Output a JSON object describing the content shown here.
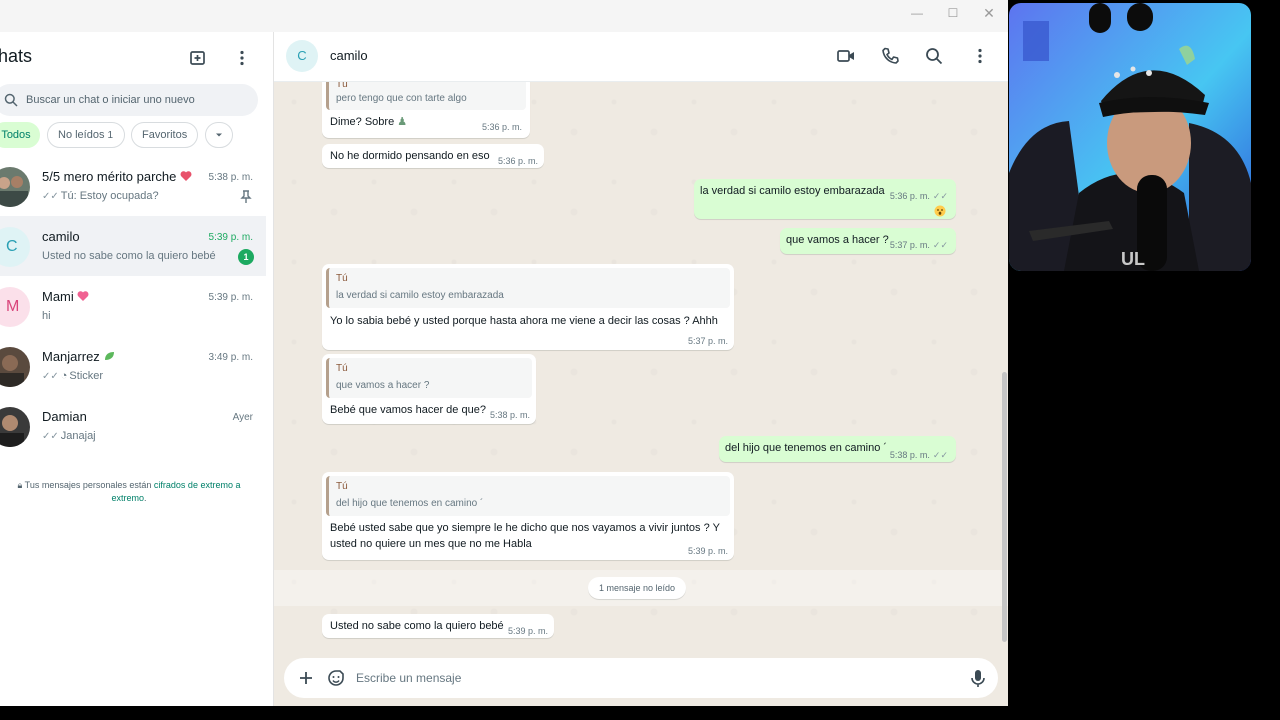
{
  "sidebar": {
    "title": "hats",
    "search_placeholder": "Buscar un chat o iniciar uno nuevo",
    "filters": [
      {
        "label": "Todos",
        "active": true
      },
      {
        "label": "No leídos",
        "count": "1",
        "active": false
      },
      {
        "label": "Favoritos",
        "active": false
      }
    ],
    "chats": [
      {
        "name": "5/5 mero mérito parche",
        "time": "5:38 p. m.",
        "preview": "Tú: Estoy ocupada?",
        "pinned": true
      },
      {
        "name": "camilo",
        "time": "5:39 p. m.",
        "preview": "Usted no sabe como la quiero bebé",
        "unread_count": "1",
        "selected": true,
        "avatar_letter": "C"
      },
      {
        "name": "Mami",
        "time": "5:39 p. m.",
        "preview": "hi",
        "avatar_letter": "M"
      },
      {
        "name": "Manjarrez",
        "time": "3:49 p. m.",
        "preview": "Sticker"
      },
      {
        "name": "Damian",
        "time": "Ayer",
        "preview": "Janajaj"
      }
    ],
    "encryption_text": "Tus mensajes personales están",
    "encryption_link": "cifrados de extremo a extremo",
    "encryption_end": "."
  },
  "conversation": {
    "contact_name": "camilo",
    "contact_initial": "C",
    "unread_banner": "1 mensaje no leído",
    "composer_placeholder": "Escribe un mensaje",
    "messages": [
      {
        "dir": "in",
        "quote_author": "Tú",
        "quote_text": "pero tengo que con tarte algo",
        "text": "Dime? Sobre",
        "time": "5:36 p. m."
      },
      {
        "dir": "in",
        "text": "No he dormido pensando en eso",
        "time": "5:36 p. m."
      },
      {
        "dir": "out",
        "text": "la verdad si camilo estoy embarazada",
        "time": "5:36 p. m."
      },
      {
        "dir": "out",
        "text": "que vamos a hacer ?",
        "time": "5:37 p. m."
      },
      {
        "dir": "in",
        "quote_author": "Tú",
        "quote_text": "la verdad si camilo estoy embarazada",
        "text": "Yo lo sabia bebé y usted porque hasta ahora me viene a decir las cosas ? Ahhh",
        "time": "5:37 p. m."
      },
      {
        "dir": "in",
        "quote_author": "Tú",
        "quote_text": "que vamos a hacer ?",
        "text": "Bebé que vamos hacer de que?",
        "time": "5:38 p. m."
      },
      {
        "dir": "out",
        "text": "del hijo que tenemos en camino ´",
        "time": "5:38 p. m."
      },
      {
        "dir": "in",
        "quote_author": "Tú",
        "quote_text": "del hijo que tenemos en camino ´",
        "text_line1": "Bebé usted sabe que yo siempre le he dicho que nos vayamos a vivir juntos ? Y",
        "text_line2": "usted no quiere un mes que no me Habla",
        "time": "5:39 p. m."
      },
      {
        "dir": "in",
        "text": "Usted no sabe como la quiero bebé",
        "time": "5:39 p. m."
      }
    ]
  },
  "colors": {
    "accent": "#1daa61",
    "outgoing_bubble": "#d9fdd3",
    "chat_background": "#efeae2"
  }
}
